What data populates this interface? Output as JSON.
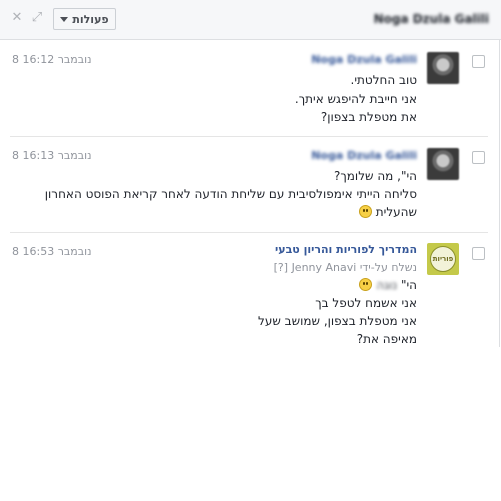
{
  "header": {
    "title": "Noga Dzula Galili",
    "actions_label": "פעולות",
    "close_icon": "close-icon",
    "expand_icon": "expand-icon"
  },
  "messages": [
    {
      "sender": "Noga Dzula Galili",
      "timestamp": "8 נובמבר 16:12",
      "lines": [
        "טוב החלטתי.",
        "אני חייבת להיפגש איתך.",
        "את מטפלת בצפון?"
      ]
    },
    {
      "sender": "Noga Dzula Galili",
      "timestamp": "8 נובמבר 16:13",
      "lines": [
        "הי\", מה שלומך?",
        "סליחה הייתי אימפולסיבית עם שליחת הודעה לאחר קריאת הפוסט האחרון",
        "שהעלית"
      ]
    },
    {
      "sender": "המדריך לפוריות והריון טבעי",
      "sent_by": "נשלח על-ידי Jenny Anavi [?]",
      "timestamp": "8 נובמבר 16:53",
      "greeting": "הי\"",
      "greeting_name": "נוגה",
      "lines": [
        "אני אשמח לטפל בך",
        "אני מטפלת בצפון, שמושב שעל",
        "מאיפה את?"
      ]
    }
  ],
  "colors": {
    "link": "#365899",
    "meta": "#90949c",
    "header_bg": "#f6f7f9"
  }
}
